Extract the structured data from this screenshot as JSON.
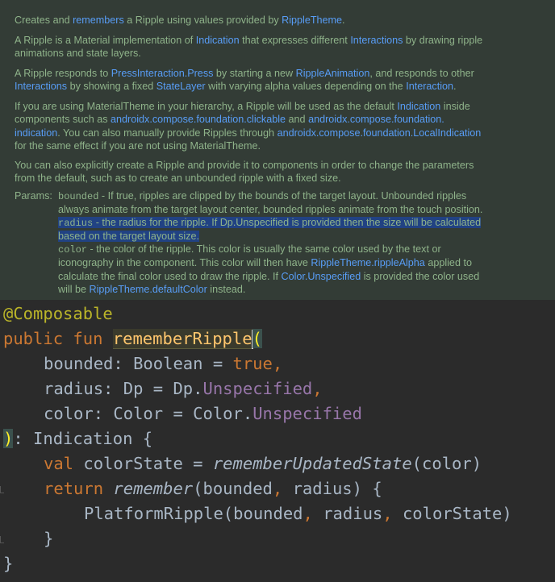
{
  "doc": {
    "p1": [
      "Creates and ",
      "remembers",
      " a Ripple using values provided by ",
      "RippleTheme",
      "."
    ],
    "p2": [
      "A Ripple is a Material implementation of ",
      "Indication",
      " that expresses different ",
      "Interactions",
      " by drawing ripple"
    ],
    "p2b": "animations and state layers.",
    "p3a": [
      "A Ripple responds to ",
      "PressInteraction.Press",
      " by starting a new ",
      "RippleAnimation",
      ", and responds to other"
    ],
    "p3b": [
      "Interactions",
      " by showing a fixed ",
      "StateLayer",
      " with varying alpha values depending on the ",
      "Interaction",
      "."
    ],
    "p4a": [
      "If you are using MaterialTheme in your hierarchy, a Ripple will be used as the default ",
      "Indication",
      " inside"
    ],
    "p4b": [
      "components such as ",
      "androidx.compose.foundation.clickable",
      " and ",
      "androidx.compose.foundation."
    ],
    "p4c": [
      "indication",
      ". You can also manually provide Ripples through ",
      "androidx.compose.foundation.LocalIndication"
    ],
    "p4d": "for the same effect if you are not using MaterialTheme.",
    "p5a": "You can also explicitly create a Ripple and provide it to components in order to change the parameters",
    "p5b": "from the default, such as to create an unbounded ripple with a fixed size.",
    "params_label": "Params:",
    "bounded_name": "bounded",
    "bounded_desc1": " - If true, ripples are clipped by the bounds of the target layout. Unbounded ripples",
    "bounded_desc2": "always animate from the target layout center, bounded ripples animate from the touch position.",
    "radius_name": "radius",
    "radius_desc1": " - the radius for the ripple. If Dp.Unspecified is provided then the size will be calculated",
    "radius_desc2": "based on the target layout size.",
    "color_name": "color",
    "color_desc1": " - the color of the ripple. This color is usually the same color used by the text or",
    "color_desc2": [
      "iconography in the component. This color will then have ",
      "RippleTheme.rippleAlpha",
      " applied to"
    ],
    "color_desc3": [
      "calculate the final color used to draw the ripple. If ",
      "Color.Unspecified",
      " is provided the color used"
    ],
    "color_desc4": [
      "will be ",
      "RippleTheme.defaultColor",
      " instead."
    ]
  },
  "code": {
    "annotation_at": "@",
    "annotation_name": "Composable",
    "kw_public": "public",
    "kw_fun": "fun",
    "fn_name": "rememberRipple",
    "open_paren": "(",
    "param1_name": "bounded: Boolean = ",
    "param1_value": "true",
    "comma": ",",
    "param2_name": "radius: Dp = Dp.",
    "param2_value": "Unspecified",
    "param3_name": "color: Color = Color.",
    "param3_value": "Unspecified",
    "close_paren": ")",
    "return_type": ": Indication {",
    "kw_val": "val",
    "var_colorstate": " colorState = ",
    "fn_remember_updated": "rememberUpdatedState",
    "args_color": "(color)",
    "kw_return": "return",
    "fn_remember": "remember",
    "args_remember_a": "(bounded",
    "args_remember_b": " radius) {",
    "platform_a": "PlatformRipple(bounded",
    "platform_b": " radius",
    "platform_c": " colorState)",
    "close_brace_inner": "}",
    "close_brace_outer": "}"
  }
}
